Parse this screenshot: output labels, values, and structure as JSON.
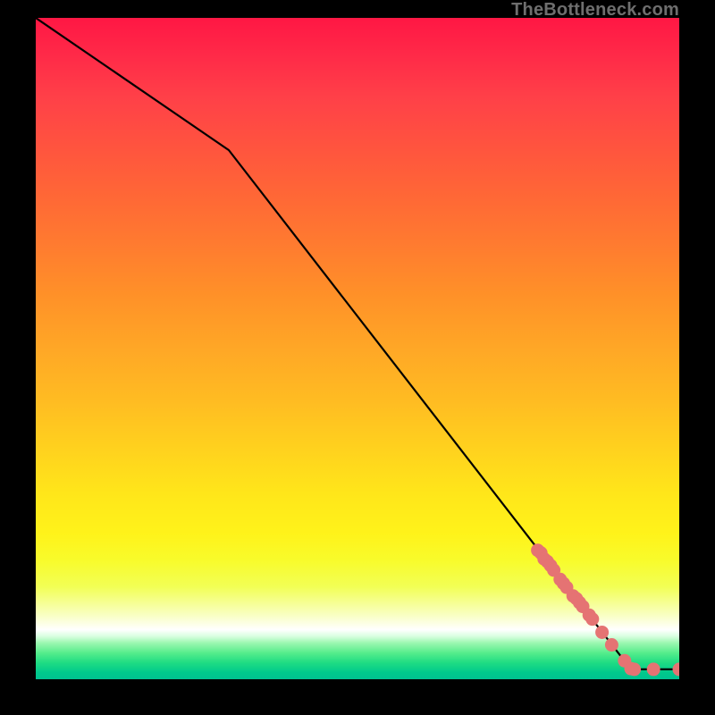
{
  "watermark": "TheBottleneck.com",
  "colors": {
    "frame_bg": "#000000",
    "line": "#000000",
    "point_fill": "#e57373",
    "point_stroke": "#c05a5a"
  },
  "chart_data": {
    "type": "line",
    "title": "",
    "xlabel": "",
    "ylabel": "",
    "xlim": [
      0,
      100
    ],
    "ylim": [
      0,
      100
    ],
    "grid": false,
    "legend": false,
    "annotations": [],
    "curve": {
      "name": "metric-curve",
      "x": [
        0,
        30,
        92.5,
        100
      ],
      "y": [
        100,
        80,
        1.5,
        1.5
      ]
    },
    "series": [
      {
        "name": "highlighted-points",
        "values": [
          {
            "x": 78.0,
            "y": 19.5
          },
          {
            "x": 78.5,
            "y": 19.1
          },
          {
            "x": 79.0,
            "y": 18.2
          },
          {
            "x": 79.5,
            "y": 17.8
          },
          {
            "x": 80.0,
            "y": 17.2
          },
          {
            "x": 80.5,
            "y": 16.5
          },
          {
            "x": 81.5,
            "y": 15.1
          },
          {
            "x": 82.0,
            "y": 14.5
          },
          {
            "x": 82.5,
            "y": 13.9
          },
          {
            "x": 83.5,
            "y": 12.6
          },
          {
            "x": 84.0,
            "y": 12.2
          },
          {
            "x": 84.5,
            "y": 11.6
          },
          {
            "x": 85.0,
            "y": 11.0
          },
          {
            "x": 86.0,
            "y": 9.7
          },
          {
            "x": 86.5,
            "y": 9.1
          },
          {
            "x": 88.0,
            "y": 7.1
          },
          {
            "x": 89.5,
            "y": 5.2
          },
          {
            "x": 91.5,
            "y": 2.8
          },
          {
            "x": 92.5,
            "y": 1.6
          },
          {
            "x": 93.0,
            "y": 1.5
          },
          {
            "x": 96.0,
            "y": 1.5
          },
          {
            "x": 100.0,
            "y": 1.5
          }
        ]
      }
    ]
  }
}
